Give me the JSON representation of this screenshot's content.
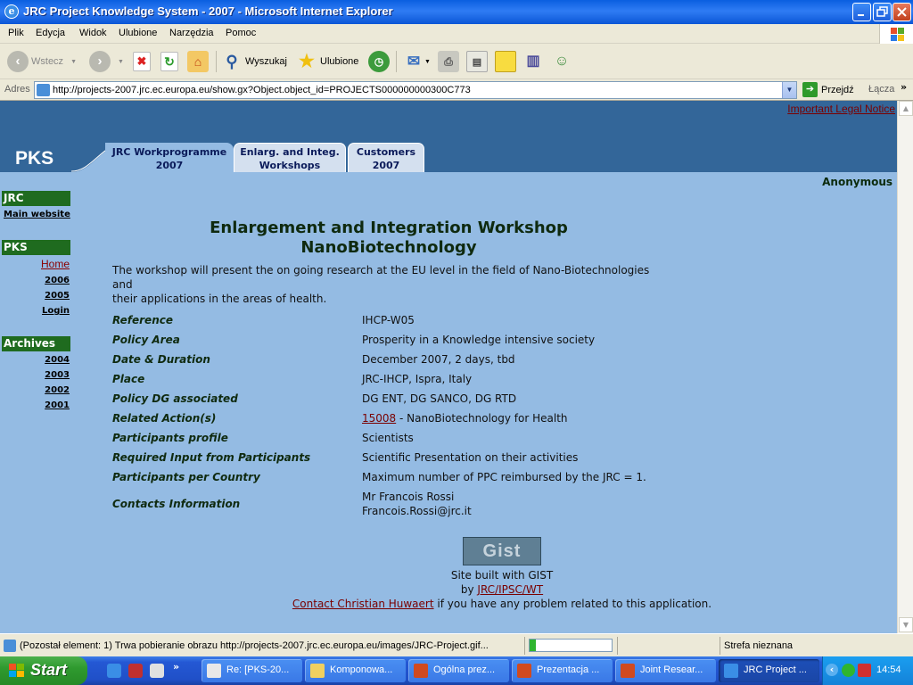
{
  "window": {
    "title": "JRC Project Knowledge System - 2007 - Microsoft Internet Explorer",
    "app_icon": "e"
  },
  "menu": [
    "Plik",
    "Edycja",
    "Widok",
    "Ulubione",
    "Narzędzia",
    "Pomoc"
  ],
  "toolbar": {
    "back_label": "Wstecz",
    "search_label": "Wyszukaj",
    "favorites_label": "Ulubione"
  },
  "address": {
    "label": "Adres",
    "url": "http://projects-2007.jrc.ec.europa.eu/show.gx?Object.object_id=PROJECTS000000000300C773",
    "go_label": "Przejdź",
    "links_label": "Łącza",
    "more": "»"
  },
  "page": {
    "legal_notice": "Important Legal Notice",
    "logo": "PKS",
    "tabs": [
      {
        "line1": "JRC Workprogramme",
        "line2": "2007"
      },
      {
        "line1": "Enlarg. and Integ.",
        "line2": "Workshops"
      },
      {
        "line1": "Customers",
        "line2": "2007"
      }
    ],
    "user": "Anonymous",
    "nav": {
      "jrc_heading": "JRC",
      "main_website": "Main website",
      "pks_heading": "PKS",
      "home": "Home",
      "y2006": "2006",
      "y2005": "2005",
      "login": "Login",
      "archives_heading": "Archives",
      "a2004": "2004",
      "a2003": "2003",
      "a2002": "2002",
      "a2001": "2001"
    },
    "title_line1": "Enlargement and Integration Workshop",
    "title_line2": "NanoBiotechnology",
    "description_line1": "The workshop will present the on going research at the EU level in the field of Nano-Biotechnologies and",
    "description_line2": "their applications in the areas of health.",
    "fields": {
      "reference_label": "Reference",
      "reference_value": "IHCP-W05",
      "policy_area_label": "Policy Area",
      "policy_area_value": "Prosperity in a Knowledge intensive society",
      "date_label": "Date & Duration",
      "date_value": "December 2007, 2 days, tbd",
      "place_label": "Place",
      "place_value": "JRC-IHCP, Ispra, Italy",
      "policy_dg_label": "Policy DG associated",
      "policy_dg_value": "DG ENT, DG SANCO, DG RTD",
      "related_label": "Related Action(s)",
      "related_link": "15008",
      "related_text": " - NanoBiotechnology for Health",
      "profile_label": "Participants profile",
      "profile_value": "Scientists",
      "input_label": "Required Input from Participants",
      "input_value": "Scientific Presentation on their activities",
      "per_country_label": "Participants per Country",
      "per_country_value": "Maximum number of PPC reimbursed by the JRC = 1.",
      "contacts_label": "Contacts Information",
      "contacts_name": "Mr Francois Rossi",
      "contacts_email": "Francois.Rossi@jrc.it"
    },
    "gist_logo": "Gist",
    "built_with": "Site built with GIST",
    "by_prefix": "by ",
    "by_link": "JRC/IPSC/WT",
    "contact_link": "Contact Christian Huwaert",
    "contact_text": " if you have any problem related to this application."
  },
  "status": {
    "text": "(Pozostał element: 1) Trwa pobieranie obrazu http://projects-2007.jrc.ec.europa.eu/images/JRC-Project.gif...",
    "progress": 0.08,
    "zone": "Strefa nieznana"
  },
  "taskbar": {
    "start_label": "Start",
    "quicklaunch_more": "»",
    "tasks": [
      "Re: [PKS-20...",
      "Komponowa...",
      "Ogólna prez...",
      "Prezentacja ...",
      "Joint Resear...",
      "JRC Project ..."
    ],
    "clock": "14:54",
    "tray_chevron": "‹"
  },
  "colors": {
    "page_bg": "#94bbe3",
    "banner": "#336699",
    "nav_heading": "#1f6b1f",
    "link_red": "#7a0000"
  }
}
